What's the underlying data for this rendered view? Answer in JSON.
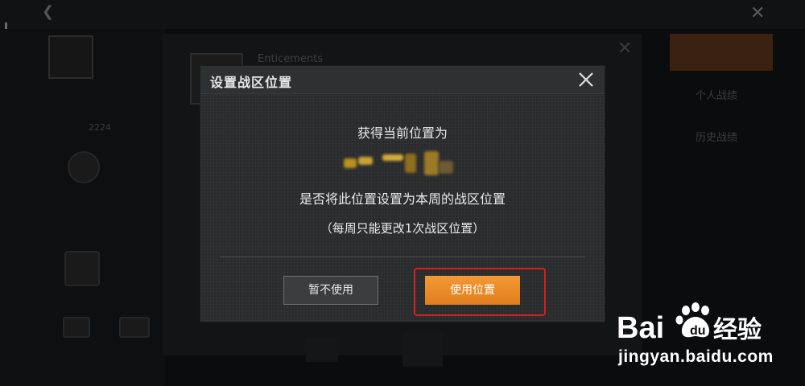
{
  "background": {
    "title": "Enticements",
    "left_id_text": "2224",
    "right_tab_1": "个人战绩",
    "right_tab_2": "历史战绩"
  },
  "dialog": {
    "title": "设置战区位置",
    "line1": "获得当前位置为",
    "line2": "是否将此位置设置为本周的战区位置",
    "line3": "（每周只能更改1次战区位置）",
    "cancel_label": "暂不使用",
    "confirm_label": "使用位置"
  },
  "colors": {
    "accent": "#f0922e",
    "highlight": "#d42020",
    "dialog_bg": "#2a2b2c"
  },
  "watermark": {
    "brand": "Bai",
    "brand_suffix": "经验",
    "url": "jingyan.baidu.com"
  }
}
